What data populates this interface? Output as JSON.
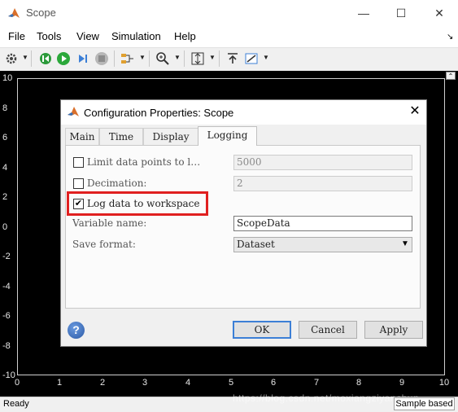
{
  "window": {
    "title": "Scope",
    "minimize_glyph": "—",
    "maximize_glyph": "☐",
    "close_glyph": "✕"
  },
  "menu": [
    "File",
    "Tools",
    "View",
    "Simulation",
    "Help"
  ],
  "toolbar_icons": [
    "gear-icon",
    "step-back-icon",
    "run-icon",
    "step-forward-icon",
    "stop-icon",
    "signal-select-icon",
    "zoom-icon",
    "autoscale-icon",
    "highlight-icon",
    "style-icon"
  ],
  "plot": {
    "y_ticks": [
      "10",
      "8",
      "6",
      "4",
      "2",
      "0",
      "-2",
      "-4",
      "-6",
      "-8",
      "-10"
    ],
    "x_ticks": [
      "0",
      "1",
      "2",
      "3",
      "4",
      "5",
      "6",
      "7",
      "8",
      "9",
      "10"
    ],
    "background": "#000000"
  },
  "status": {
    "text": "Ready",
    "mode": "Sample based",
    "watermark": "https://blog.csdn.net/moxiangziyanchun"
  },
  "dialog": {
    "title": "Configuration Properties: Scope",
    "tabs": [
      "Main",
      "Time",
      "Display",
      "Logging"
    ],
    "active_tab": "Logging",
    "rows": {
      "limit_label": "Limit data points to l…",
      "limit_value": "5000",
      "decimation_label": "Decimation:",
      "decimation_value": "2",
      "log_label": "Log data to workspace",
      "log_checked": "✔",
      "varname_label": "Variable name:",
      "varname_value": "ScopeData",
      "format_label": "Save format:",
      "format_value": "Dataset"
    },
    "buttons": {
      "ok": "OK",
      "cancel": "Cancel",
      "apply": "Apply",
      "help": "?"
    }
  },
  "colors": {
    "highlight": "#e02020",
    "accent": "#3c7fd6"
  }
}
